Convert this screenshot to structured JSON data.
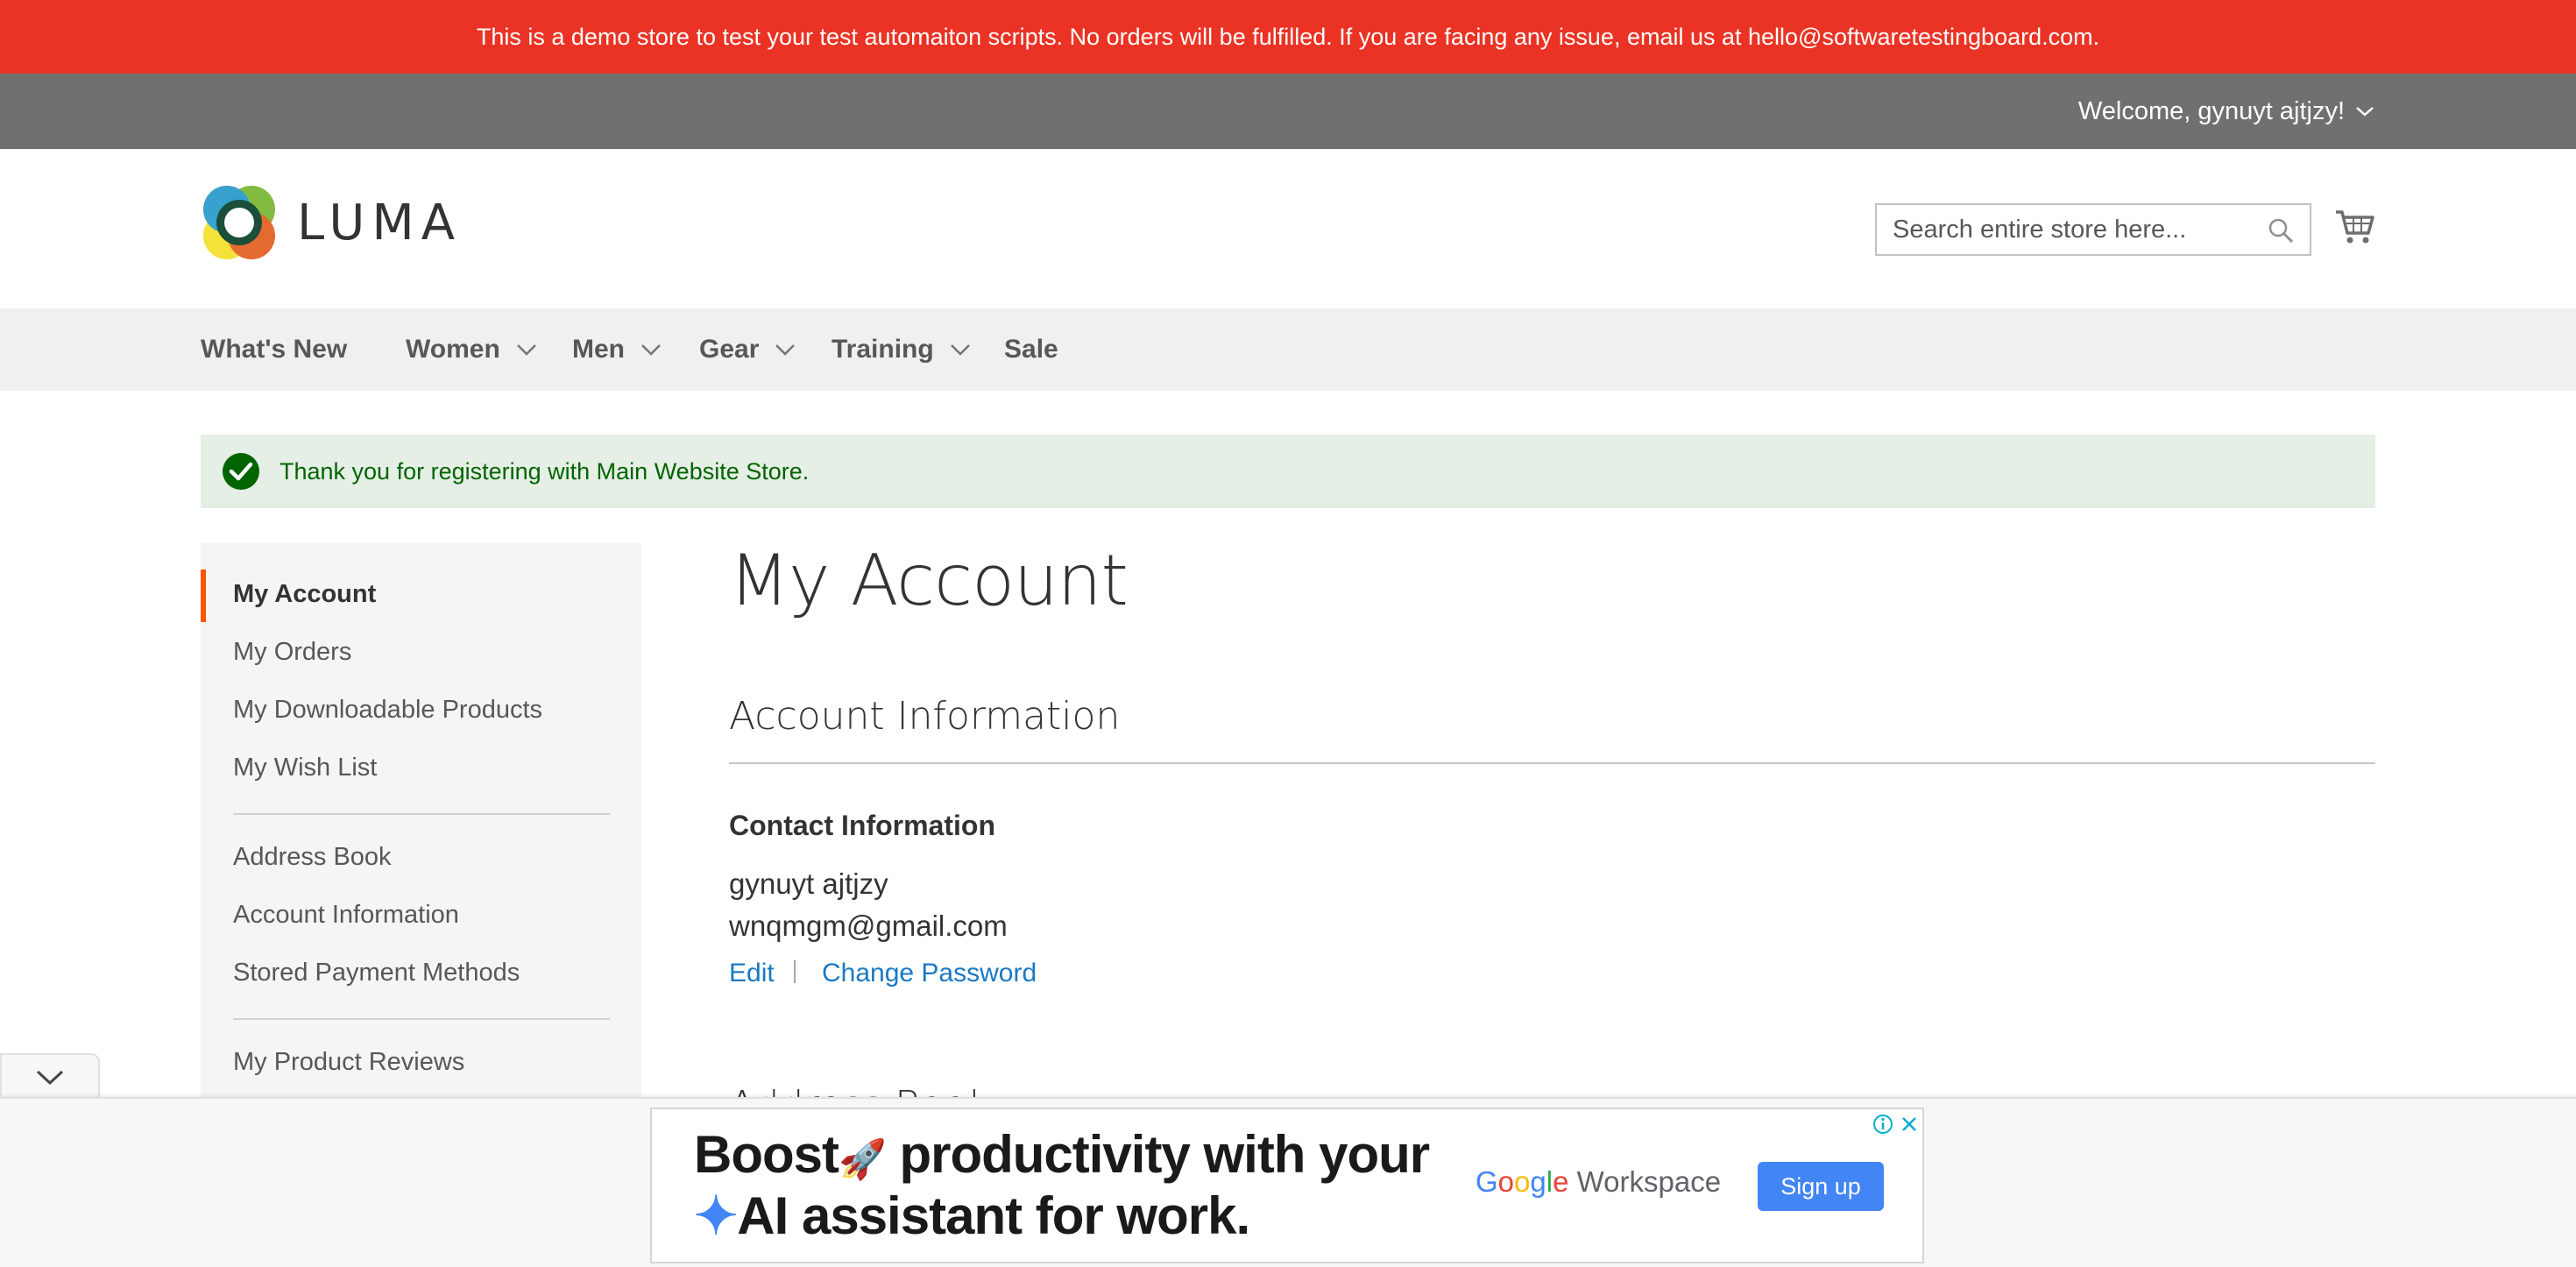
{
  "banner": {
    "text": "This is a demo store to test your test automaiton scripts. No orders will be fulfilled. If you are facing any issue, email us at hello@softwaretestingboard.com.",
    "color": "#ea3324"
  },
  "top_bar": {
    "welcome": "Welcome, gynuyt ajtjzy!"
  },
  "header": {
    "logo_text": "LUMA",
    "search_placeholder": "Search entire store here..."
  },
  "nav": {
    "items": [
      {
        "label": "What's New"
      },
      {
        "label": "Women"
      },
      {
        "label": "Men"
      },
      {
        "label": "Gear"
      },
      {
        "label": "Training"
      },
      {
        "label": "Sale"
      }
    ]
  },
  "message": {
    "success": "Thank you for registering with Main Website Store."
  },
  "sidebar": {
    "items": [
      {
        "label": "My Account"
      },
      {
        "label": "My Orders"
      },
      {
        "label": "My Downloadable Products"
      },
      {
        "label": "My Wish List"
      },
      {
        "label": "Address Book"
      },
      {
        "label": "Account Information"
      },
      {
        "label": "Stored Payment Methods"
      },
      {
        "label": "My Product Reviews"
      }
    ],
    "active_color": "#ff5501"
  },
  "main": {
    "title": "My Account",
    "section_title": "Account Information",
    "contact": {
      "title": "Contact Information",
      "name": "gynuyt ajtjzy",
      "email": "wnqmgm@gmail.com",
      "edit": "Edit",
      "change_password": "Change Password",
      "separator": "|"
    },
    "next_section_peek": "Address Book"
  },
  "ad": {
    "line1_word1": "Boost",
    "line1_rest": "productivity with your",
    "line2": "AI assistant for work.",
    "brand_workspace": "Workspace",
    "cta": "Sign up"
  }
}
